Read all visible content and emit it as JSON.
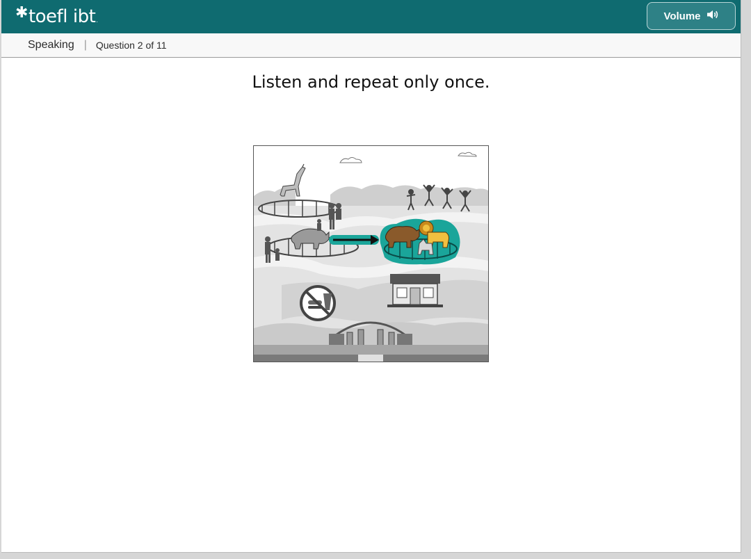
{
  "header": {
    "logo_main": "toefl",
    "logo_sub": "ibt",
    "volume_label": "Volume"
  },
  "subheader": {
    "section": "Speaking",
    "separator": "|",
    "question_counter": "Question 2 of 11"
  },
  "main": {
    "instruction": "Listen and repeat only once."
  },
  "colors": {
    "brand": "#0f6b70",
    "highlight": "#1aa59a"
  }
}
